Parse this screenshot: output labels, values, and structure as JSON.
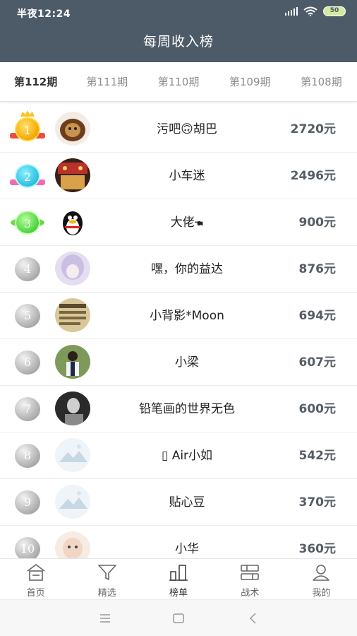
{
  "status_bar": {
    "time": "半夜12:24",
    "battery": "50"
  },
  "app_title": "每周收入榜",
  "tabs": [
    {
      "label": "第112期",
      "active": true
    },
    {
      "label": "第111期",
      "active": false
    },
    {
      "label": "第110期",
      "active": false
    },
    {
      "label": "第109期",
      "active": false
    },
    {
      "label": "第108期",
      "active": false
    }
  ],
  "ranking": [
    {
      "rank": "1",
      "name": "污吧🙃胡巴",
      "amount": "2720元"
    },
    {
      "rank": "2",
      "name": "小车迷",
      "amount": "2496元"
    },
    {
      "rank": "3",
      "name": "大佬🖜",
      "amount": "900元"
    },
    {
      "rank": "4",
      "name": "嘿，你的益达",
      "amount": "876元"
    },
    {
      "rank": "5",
      "name": "小背影*Moon",
      "amount": "694元"
    },
    {
      "rank": "6",
      "name": "小梁",
      "amount": "607元"
    },
    {
      "rank": "7",
      "name": "铅笔画的世界无色",
      "amount": "600元"
    },
    {
      "rank": "8",
      "name": "▯ Air小如",
      "amount": "542元"
    },
    {
      "rank": "9",
      "name": "贴心豆",
      "amount": "370元"
    },
    {
      "rank": "10",
      "name": "小华",
      "amount": "360元"
    }
  ],
  "bottom_nav": [
    {
      "label": "首页",
      "icon": "home-icon",
      "active": false
    },
    {
      "label": "精选",
      "icon": "filter-icon",
      "active": false
    },
    {
      "label": "榜单",
      "icon": "ranking-icon",
      "active": true
    },
    {
      "label": "战术",
      "icon": "tactics-icon",
      "active": false
    },
    {
      "label": "我的",
      "icon": "profile-icon",
      "active": false
    }
  ],
  "colors": {
    "header": "#4d5b69",
    "amount": "#555d66"
  }
}
